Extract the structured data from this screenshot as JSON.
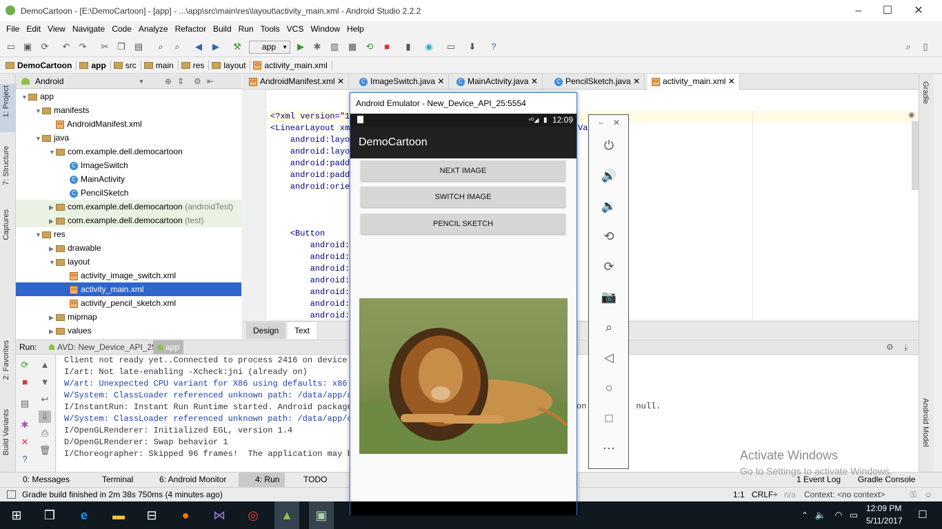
{
  "window": {
    "title": "DemoCartoon - [E:\\DemoCartoon] - [app] - ...\\app\\src\\main\\res\\layout\\activity_main.xml - Android Studio 2.2.2"
  },
  "menu": [
    "File",
    "Edit",
    "View",
    "Navigate",
    "Code",
    "Analyze",
    "Refactor",
    "Build",
    "Run",
    "Tools",
    "VCS",
    "Window",
    "Help"
  ],
  "toolbar": {
    "run_config": "app"
  },
  "breadcrumb": [
    "DemoCartoon",
    "app",
    "src",
    "main",
    "res",
    "layout",
    "activity_main.xml"
  ],
  "project": {
    "view": "Android",
    "tree": [
      {
        "label": "app",
        "indent": 0,
        "icon": "folder",
        "expanded": true
      },
      {
        "label": "manifests",
        "indent": 1,
        "icon": "folder",
        "expanded": true
      },
      {
        "label": "AndroidManifest.xml",
        "indent": 2,
        "icon": "xml"
      },
      {
        "label": "java",
        "indent": 1,
        "icon": "folder",
        "expanded": true
      },
      {
        "label": "com.example.dell.democartoon",
        "indent": 2,
        "icon": "folder",
        "expanded": true
      },
      {
        "label": "ImageSwitch",
        "indent": 3,
        "icon": "class"
      },
      {
        "label": "MainActivity",
        "indent": 3,
        "icon": "class"
      },
      {
        "label": "PencilSketch",
        "indent": 3,
        "icon": "class"
      },
      {
        "label": "com.example.dell.democartoon",
        "suffix": "(androidTest)",
        "indent": 2,
        "icon": "folder",
        "expanded": false,
        "green": true
      },
      {
        "label": "com.example.dell.democartoon",
        "suffix": "(test)",
        "indent": 2,
        "icon": "folder",
        "expanded": false,
        "green": true
      },
      {
        "label": "res",
        "indent": 1,
        "icon": "folder",
        "expanded": true
      },
      {
        "label": "drawable",
        "indent": 2,
        "icon": "folder",
        "expanded": false
      },
      {
        "label": "layout",
        "indent": 2,
        "icon": "folder",
        "expanded": true
      },
      {
        "label": "activity_image_switch.xml",
        "indent": 3,
        "icon": "xml"
      },
      {
        "label": "activity_main.xml",
        "indent": 3,
        "icon": "xml",
        "selected": true
      },
      {
        "label": "activity_pencil_sketch.xml",
        "indent": 3,
        "icon": "xml"
      },
      {
        "label": "mipmap",
        "indent": 2,
        "icon": "folder",
        "expanded": false
      },
      {
        "label": "values",
        "indent": 2,
        "icon": "folder",
        "expanded": false
      }
    ]
  },
  "editor_tabs": [
    "AndroidManifest.xml",
    "ImageSwitch.java",
    "MainActivity.java",
    "PencilSketch.java",
    "activity_main.xml"
  ],
  "code_lines": [
    "<?xml version=\"1",
    "<LinearLayout xml",
    "    android:layou",
    "    android:layou",
    "    android:paddi",
    "    android:paddi",
    "    android:orien",
    "",
    "",
    "",
    "    <Button",
    "        android:i",
    "        android:l",
    "        android:l",
    "        android:l",
    "        android:l",
    "        android:t",
    "        android:c"
  ],
  "code_right": "Van",
  "design_tabs": [
    "Design",
    "Text"
  ],
  "run": {
    "label": "Run:",
    "tabs": [
      "AVD: New_Device_API_25",
      "app"
    ],
    "console": [
      {
        "text": "Client not ready yet..Connected to process 2416 on device N",
        "c": "black"
      },
      {
        "text": "I/art: Not late-enabling -Xcheck:jni (already on)",
        "c": "black"
      },
      {
        "text": "W/art: Unexpected CPU variant for X86 using defaults: x86",
        "c": "blue"
      },
      {
        "text": "W/System: ClassLoader referenced unknown path: /data/app/co",
        "c": "blue"
      },
      {
        "text": "I/InstantRun: Instant Run Runtime started. Android package",
        "c": "black"
      },
      {
        "text": "W/System: ClassLoader referenced unknown path: /data/app/co",
        "c": "blue"
      },
      {
        "text": "I/OpenGLRenderer: Initialized EGL, version 1.4",
        "c": "black"
      },
      {
        "text": "D/OpenGLRenderer: Swap behavior 1",
        "c": "black"
      },
      {
        "text": "I/Choreographer: Skipped 96 frames!  The application may be",
        "c": "black"
      }
    ],
    "console_tail": "on          null."
  },
  "bottom_tabs": [
    "0: Messages",
    "Terminal",
    "6: Android Monitor",
    "4: Run",
    "TODO",
    "1 Event Log",
    "Gradle Console"
  ],
  "status": {
    "message": "Gradle build finished in 2m 38s 750ms (4 minutes ago)",
    "position": "1:1",
    "line_sep": "CRLF÷",
    "encoding": "n/a",
    "context": "Context: <no context>"
  },
  "left_tools": [
    "1: Project",
    "7: Structure",
    "Captures",
    "2: Favorites",
    "Build Variants"
  ],
  "right_tools": [
    "Gradle",
    "Android Model"
  ],
  "emulator": {
    "title": "Android Emulator - New_Device_API_25:5554",
    "time": "12:09",
    "app_title": "DemoCartoon",
    "buttons": [
      "NEXT IMAGE",
      "SWITCH IMAGE",
      "PENCIL SKETCH"
    ]
  },
  "watermark": {
    "line1": "Activate Windows",
    "line2": "Go to Settings to activate Windows."
  },
  "taskbar": {
    "time": "12:09 PM",
    "date": "5/11/2017"
  },
  "colors": {
    "accent": "#2f65ca",
    "appbar": "#212121"
  }
}
